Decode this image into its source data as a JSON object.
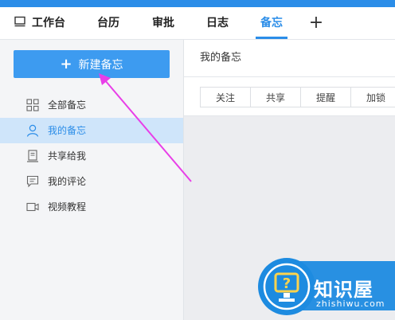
{
  "nav": {
    "tabs": [
      {
        "label": "工作台",
        "icon": "monitor-icon"
      },
      {
        "label": "台历"
      },
      {
        "label": "审批"
      },
      {
        "label": "日志"
      },
      {
        "label": "备忘",
        "active": true
      }
    ],
    "add_label": "+"
  },
  "sidebar": {
    "new_button": {
      "plus": "+",
      "label": "新建备忘"
    },
    "items": [
      {
        "label": "全部备忘",
        "icon": "grid-icon"
      },
      {
        "label": "我的备忘",
        "icon": "user-icon",
        "active": true
      },
      {
        "label": "共享给我",
        "icon": "document-icon"
      },
      {
        "label": "我的评论",
        "icon": "comment-icon"
      },
      {
        "label": "视频教程",
        "icon": "video-icon"
      }
    ]
  },
  "main": {
    "title": "我的备忘",
    "toolbar": [
      "关注",
      "共享",
      "提醒",
      "加锁"
    ]
  },
  "watermark": {
    "title": "知识屋",
    "subtitle": "zhishiwu.com"
  },
  "colors": {
    "accent": "#2b8de8",
    "button": "#3d9bf0",
    "annotation_arrow": "#e83ee8"
  }
}
